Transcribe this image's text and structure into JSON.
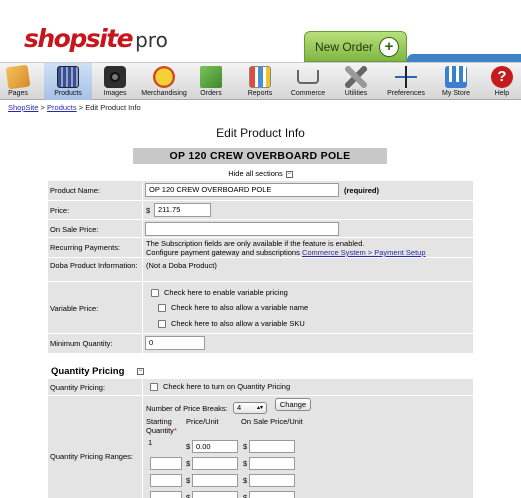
{
  "brand": {
    "name": "shopsite",
    "suffix": "pro",
    "brand_color": "#c4161c"
  },
  "new_order": {
    "label": "New Order",
    "plus": "+"
  },
  "toolbar": [
    {
      "key": "pages",
      "label": "Pages",
      "icon": "pages-icon",
      "color": "#e2a33a",
      "active": false
    },
    {
      "key": "products",
      "label": "Products",
      "icon": "products-icon",
      "color": "#3a4f8c",
      "active": true
    },
    {
      "key": "images",
      "label": "Images",
      "icon": "camera-icon",
      "color": "#333333",
      "active": false
    },
    {
      "key": "merchandising",
      "label": "Merchandising",
      "icon": "specials-icon",
      "color": "#e8c21a",
      "active": false
    },
    {
      "key": "orders",
      "label": "Orders",
      "icon": "orders-icon",
      "color": "#4c9a3a",
      "active": false
    },
    {
      "key": "reports",
      "label": "Reports",
      "icon": "reports-icon",
      "color": "#4a8fd0",
      "active": false
    },
    {
      "key": "commerce",
      "label": "Commerce",
      "icon": "cart-icon",
      "color": "#777777",
      "active": false
    },
    {
      "key": "utilities",
      "label": "Utilities",
      "icon": "utilities-icon",
      "color": "#9a9a9a",
      "active": false
    },
    {
      "key": "preferences",
      "label": "Preferences",
      "icon": "preferences-icon",
      "color": "#2a66b8",
      "active": false
    },
    {
      "key": "mystore",
      "label": "My Store",
      "icon": "store-icon",
      "color": "#3a7fd0",
      "active": false
    },
    {
      "key": "help",
      "label": "Help",
      "icon": "help-icon",
      "color": "#c41c1c",
      "active": false
    }
  ],
  "breadcrumb": {
    "home": "ShopSite",
    "sep1": ">",
    "products": "Products",
    "sep2": ">",
    "current": "Edit Product Info"
  },
  "page_title": "Edit Product Info",
  "product_banner": "OP 120 CREW OVERBOARD POLE",
  "hide_all": "Hide all sections",
  "toggle_minus": "⊟",
  "fields": {
    "product_name": {
      "label": "Product Name:",
      "value": "OP 120 CREW OVERBOARD POLE",
      "required": "(required)"
    },
    "price": {
      "label": "Price:",
      "currency": "$",
      "value": "211.75"
    },
    "on_sale_price": {
      "label": "On Sale Price:",
      "value": ""
    },
    "recurring": {
      "label": "Recurring Payments:",
      "line1": "The Subscription fields are only available if the feature is enabled.",
      "line2": "Configure payment gateway and subscriptions",
      "link": "Commerce System > Payment Setup"
    },
    "doba": {
      "label": "Doba Product Information:",
      "value": "(Not a Doba Product)"
    },
    "variable_price": {
      "label": "Variable Price:",
      "opt1": "Check here to enable variable pricing",
      "opt2": "Check here to also allow a variable name",
      "opt3": "Check here to also allow a variable SKU"
    },
    "min_qty": {
      "label": "Minimum Quantity:",
      "value": "0"
    }
  },
  "quantity_section": {
    "title": "Quantity Pricing",
    "pricing_label": "Quantity Pricing:",
    "pricing_opt": "Check here to turn on Quantity Pricing",
    "ranges_label": "Quantity Pricing Ranges:",
    "breaks_label": "Number of Price Breaks:",
    "breaks_value": "4",
    "change_button": "Change",
    "col_start": "Starting",
    "col_qty": "Quantity",
    "required_star": "*",
    "col_price": "Price/Unit",
    "col_sale": "On Sale Price/Unit",
    "row1_start": "1",
    "row1_price": "0.00",
    "currency": "$"
  }
}
